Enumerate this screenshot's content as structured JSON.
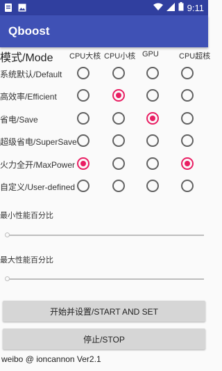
{
  "status_bar": {
    "time": "9:11",
    "left_icons": [
      "notification-icon",
      "image-icon"
    ],
    "right_icons": [
      "wifi-icon",
      "signal-icon",
      "battery-icon"
    ]
  },
  "app_bar": {
    "title": "Qboost"
  },
  "table": {
    "mode_title": "模式/Mode",
    "columns": [
      "CPU大核",
      "CPU小核",
      "GPU",
      "CPU超核"
    ],
    "rows": [
      {
        "label": "系统默认/Default",
        "selected": [
          false,
          false,
          false,
          false
        ]
      },
      {
        "label": "高效率/Efficient",
        "selected": [
          false,
          true,
          false,
          false
        ]
      },
      {
        "label": "省电/Save",
        "selected": [
          false,
          false,
          true,
          false
        ]
      },
      {
        "label": "超级省电/SuperSave",
        "selected": [
          false,
          false,
          false,
          false
        ]
      },
      {
        "label": "火力全开/MaxPower",
        "selected": [
          true,
          false,
          false,
          true
        ]
      },
      {
        "label": "自定义/User-defined",
        "selected": [
          false,
          false,
          false,
          false
        ]
      }
    ]
  },
  "min_perf": {
    "label": "最小性能百分比",
    "value_fraction": 0
  },
  "max_perf": {
    "label": "最大性能百分比",
    "value_fraction": 0
  },
  "buttons": {
    "start": "开始并设置/START AND SET",
    "stop": "停止/STOP"
  },
  "footer": "weibo @ ioncannon Ver2.1",
  "colors": {
    "status_bar": "#303f9f",
    "app_bar": "#3f51b5",
    "accent": "#e91e63",
    "radio_unchecked": "#616161",
    "button": "#d6d6d6"
  }
}
